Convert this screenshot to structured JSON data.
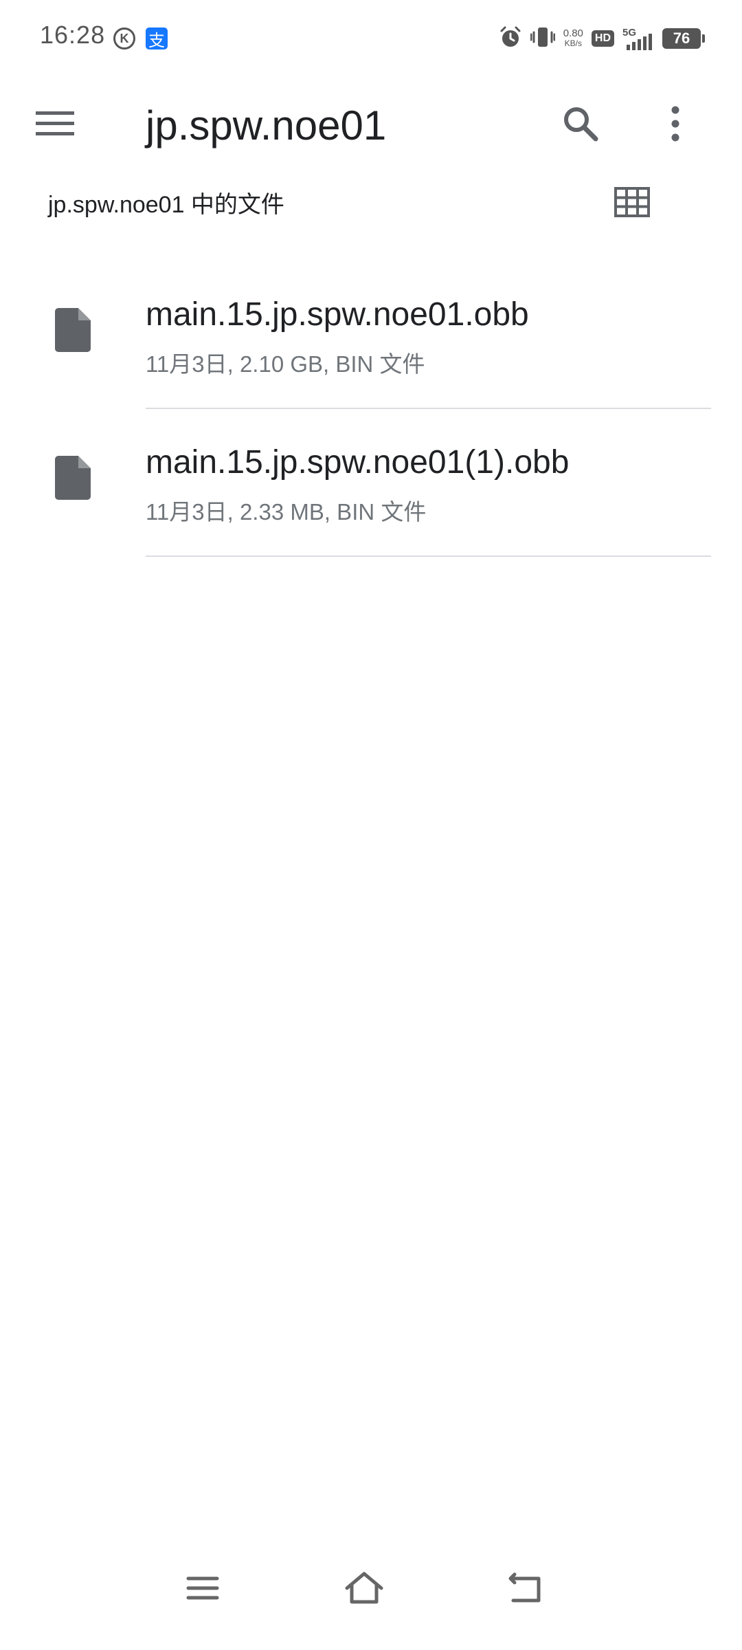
{
  "status_bar": {
    "time": "16:28",
    "k_icon_label": "K",
    "alipay_icon_label": "支",
    "net_speed_value": "0.80",
    "net_speed_unit": "KB/s",
    "hd_label": "HD",
    "network_type": "5G",
    "battery_level": "76",
    "icons": [
      "k-icon",
      "alipay-icon",
      "alarm-icon",
      "vibrate-icon",
      "hd-icon",
      "signal-icon",
      "battery-icon"
    ]
  },
  "app_bar": {
    "title": "jp.spw.noe01",
    "icons": [
      "menu-icon",
      "search-icon",
      "more-vert-icon"
    ]
  },
  "subheader": {
    "label": "jp.spw.noe01 中的文件",
    "icon": "grid-view-icon"
  },
  "files": [
    {
      "name": "main.15.jp.spw.noe01.obb",
      "meta": "11月3日, 2.10 GB, BIN 文件",
      "icon": "file-icon"
    },
    {
      "name": "main.15.jp.spw.noe01(1).obb",
      "meta": "11月3日, 2.33 MB, BIN 文件",
      "icon": "file-icon"
    }
  ],
  "nav_bar": {
    "icons": [
      "recents-icon",
      "home-icon",
      "back-icon"
    ]
  },
  "colors": {
    "text_primary": "#202124",
    "text_secondary": "#70757a",
    "icon_grey": "#5f6368",
    "divider": "#dadce0",
    "alipay_blue": "#1677ff"
  }
}
